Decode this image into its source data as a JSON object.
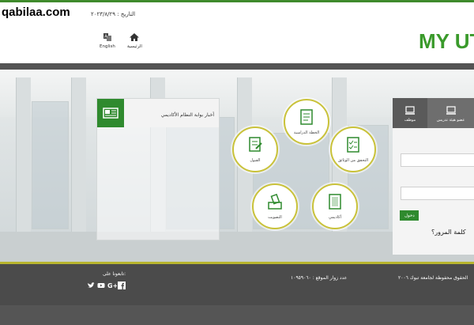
{
  "watermark": "qabilaa.com",
  "header": {
    "date": "التاريخ : ٢٠٢٣/٨/٢٩",
    "home_label": "الرئيسية",
    "english_label": "English",
    "logo_text": "MY UT"
  },
  "news": {
    "title": "أخبار بوابة النظام الأكاديمي"
  },
  "services": [
    {
      "label": "الخطة الدراسية",
      "icon": "study-plan-icon"
    },
    {
      "label": "القبول",
      "icon": "admission-icon"
    },
    {
      "label": "التحقق من الوثائق",
      "icon": "document-verify-icon"
    },
    {
      "label": "التصويت",
      "icon": "voting-icon"
    },
    {
      "label": "أكاديمي",
      "icon": "academic-book-icon"
    }
  ],
  "login": {
    "tab_faculty": "عضو هيئة تدريس",
    "tab_employee": "موظف",
    "login_button": "دخول",
    "forgot": "كلمة المرور؟"
  },
  "footer": {
    "follow": "تابعونا على:",
    "visitors": "عدد زوار الموقع : ١٠٩٥٩٠٦٠",
    "copyright": "الحقوق محفوظة لجامعة تبوك ٢٠٠٦"
  },
  "colors": {
    "green": "#2f8a2e",
    "olive": "#b8b52f",
    "footer": "#4b4b4b"
  }
}
